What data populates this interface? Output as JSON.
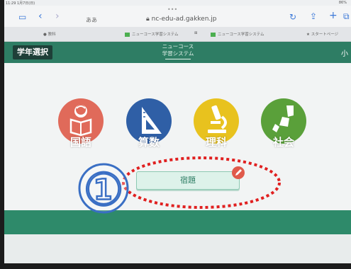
{
  "status_bar": {
    "time": "11:29 1月7日(日)",
    "battery": "86%"
  },
  "browser": {
    "text_size_label": "ああ",
    "url": "nc-edu-ad.gakken.jp",
    "tabs": [
      {
        "label": "教科"
      },
      {
        "label": "ニューコース学習システム"
      },
      {
        "label": "ニューコース学習システム"
      },
      {
        "label": "スタートページ"
      }
    ]
  },
  "app": {
    "grade_select_label": "学年選択",
    "logo_line1": "ニューコース",
    "logo_line2": "学習システム",
    "user_initial": "小",
    "subjects": [
      {
        "label": "国語",
        "color": "#e06a5a",
        "icon": "reading-child-icon"
      },
      {
        "label": "算数",
        "color": "#2f5fa6",
        "icon": "triangle-ruler-icon"
      },
      {
        "label": "理科",
        "color": "#e8c21e",
        "icon": "microscope-icon"
      },
      {
        "label": "社会",
        "color": "#5aa03a",
        "icon": "map-pieces-icon"
      }
    ],
    "homework_label": "宿題",
    "accent_color": "#2e7d64"
  },
  "annotation": {
    "step_number": "①",
    "color": "#e02020"
  }
}
